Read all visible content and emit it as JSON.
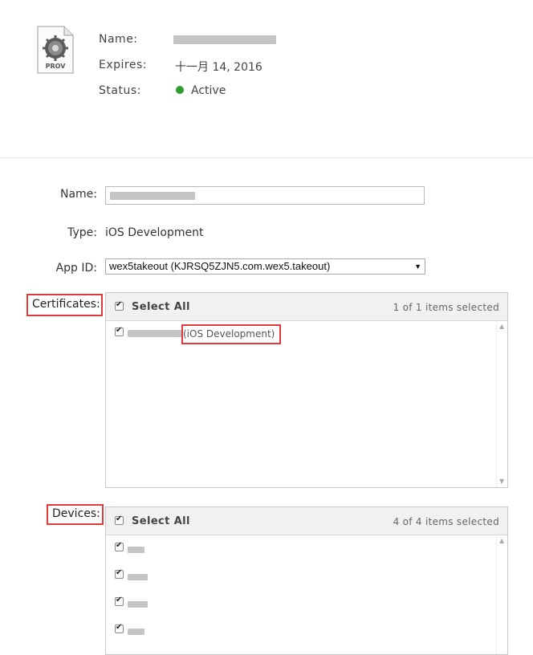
{
  "profile": {
    "icon_text": "PROV",
    "name_label": "Name:",
    "name_value": "",
    "expires_label": "Expires:",
    "expires_value": "十一月 14, 2016",
    "status_label": "Status:",
    "status_value": "Active",
    "status_color": "#2ca02c"
  },
  "form": {
    "name_label": "Name:",
    "name_value": "",
    "type_label": "Type:",
    "type_value": "iOS Development",
    "appid_label": "App ID:",
    "appid_value": "wex5takeout (KJRSQ5ZJN5.com.wex5.takeout)"
  },
  "certificates": {
    "label": "Certificates:",
    "select_all": "Select All",
    "count_text": "1 of 1 items selected",
    "items": [
      {
        "name": "",
        "type": "(iOS Development)"
      }
    ]
  },
  "devices": {
    "label": "Devices:",
    "select_all": "Select All",
    "count_text": "4 of 4 items selected",
    "items": [
      "",
      "",
      "",
      ""
    ]
  },
  "colors": {
    "highlight": "#e23a3a"
  }
}
